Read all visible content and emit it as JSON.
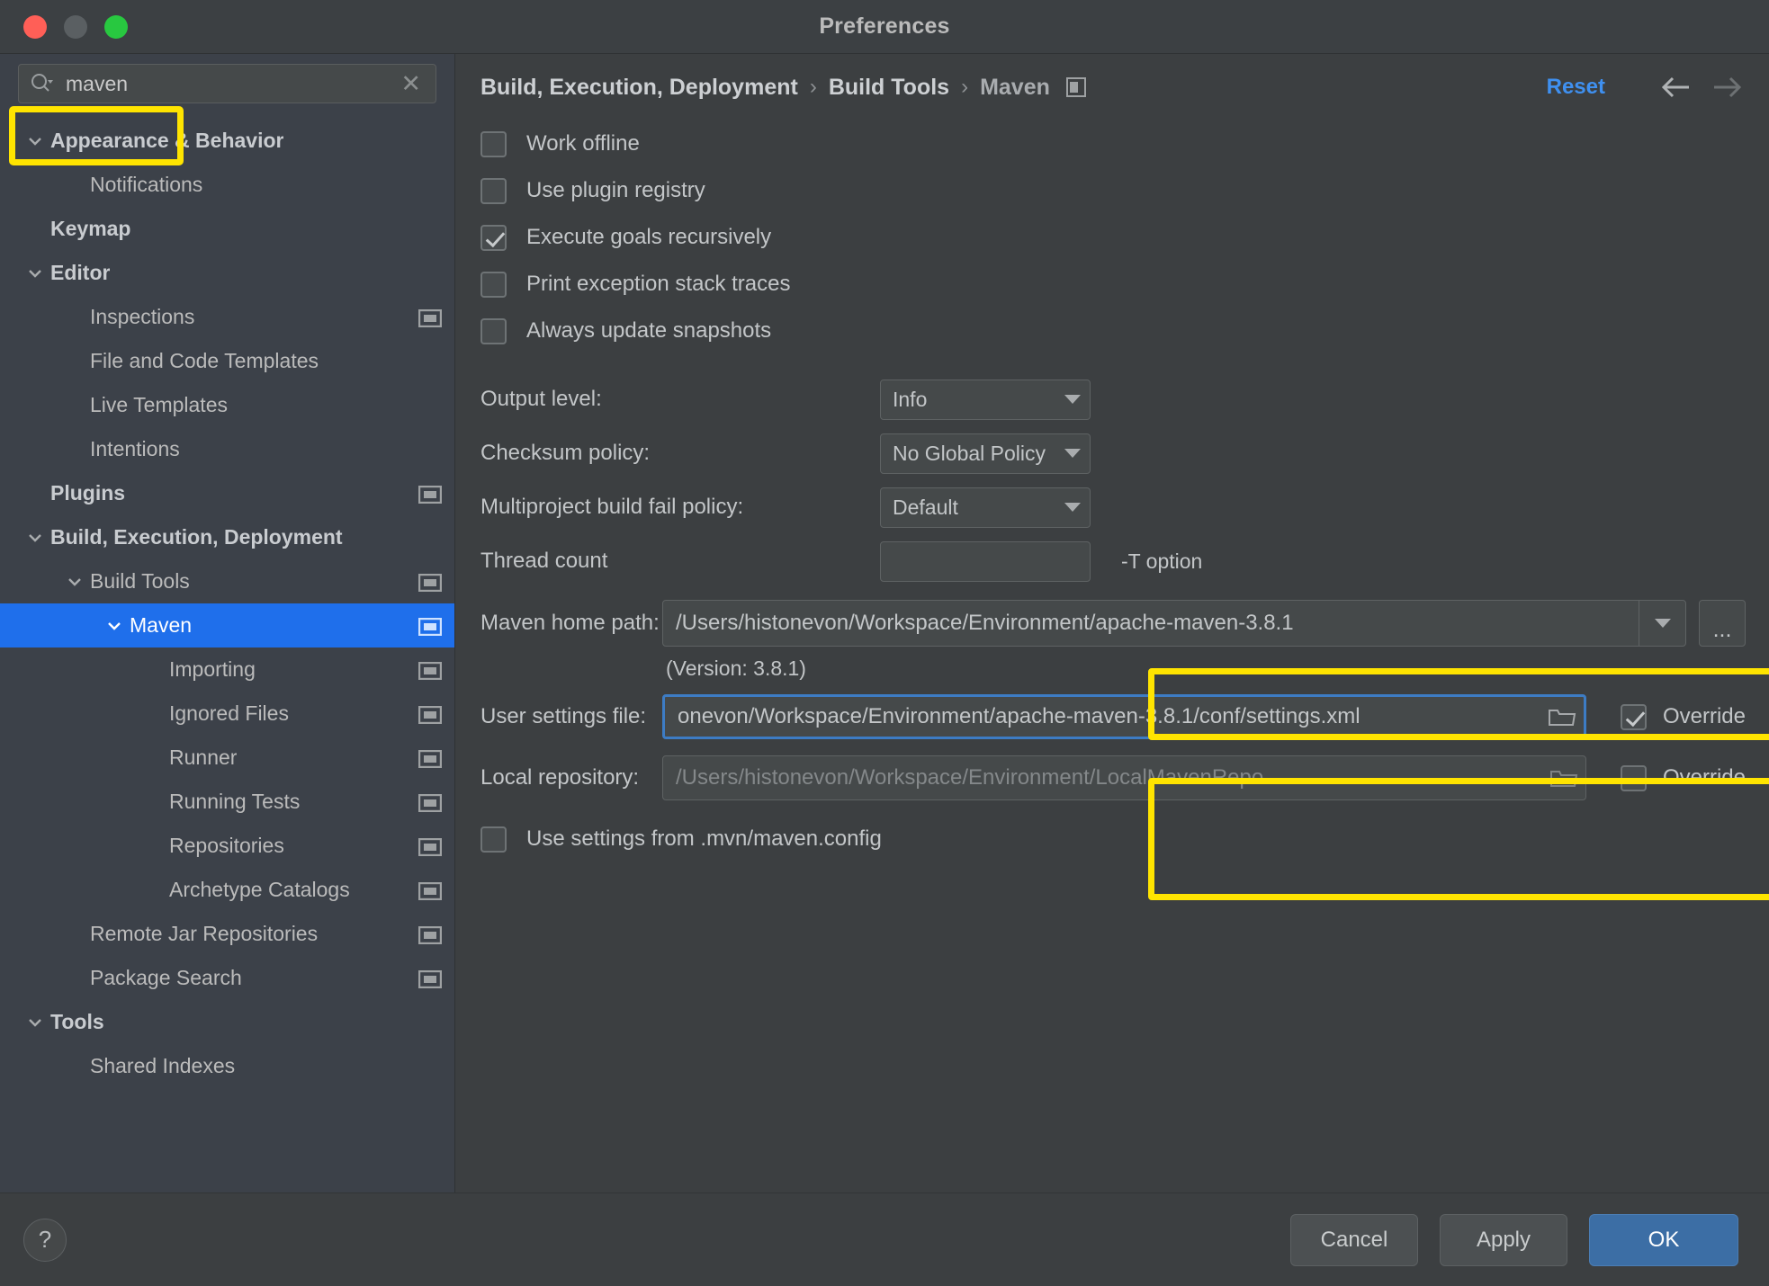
{
  "window": {
    "title": "Preferences",
    "traffic_lights": [
      "close-button",
      "minimize-button",
      "maximize-button"
    ]
  },
  "sidebar": {
    "search": {
      "icon": "search-icon",
      "value": "maven",
      "placeholder": "",
      "clear_icon": "close-icon"
    },
    "items": [
      {
        "label": "Appearance & Behavior",
        "indent": 0,
        "bold": true,
        "expandable": true,
        "expanded": true,
        "selected": false,
        "panel_icon": false
      },
      {
        "label": "Notifications",
        "indent": 1,
        "bold": false,
        "expandable": false,
        "expanded": false,
        "selected": false,
        "panel_icon": false
      },
      {
        "label": "Keymap",
        "indent": 0,
        "bold": true,
        "expandable": false,
        "expanded": false,
        "selected": false,
        "panel_icon": false
      },
      {
        "label": "Editor",
        "indent": 0,
        "bold": true,
        "expandable": true,
        "expanded": true,
        "selected": false,
        "panel_icon": false
      },
      {
        "label": "Inspections",
        "indent": 1,
        "bold": false,
        "expandable": false,
        "expanded": false,
        "selected": false,
        "panel_icon": true
      },
      {
        "label": "File and Code Templates",
        "indent": 1,
        "bold": false,
        "expandable": false,
        "expanded": false,
        "selected": false,
        "panel_icon": false
      },
      {
        "label": "Live Templates",
        "indent": 1,
        "bold": false,
        "expandable": false,
        "expanded": false,
        "selected": false,
        "panel_icon": false
      },
      {
        "label": "Intentions",
        "indent": 1,
        "bold": false,
        "expandable": false,
        "expanded": false,
        "selected": false,
        "panel_icon": false
      },
      {
        "label": "Plugins",
        "indent": 0,
        "bold": true,
        "expandable": false,
        "expanded": false,
        "selected": false,
        "panel_icon": true
      },
      {
        "label": "Build, Execution, Deployment",
        "indent": 0,
        "bold": true,
        "expandable": true,
        "expanded": true,
        "selected": false,
        "panel_icon": false
      },
      {
        "label": "Build Tools",
        "indent": 1,
        "bold": false,
        "expandable": true,
        "expanded": true,
        "selected": false,
        "panel_icon": true
      },
      {
        "label": "Maven",
        "indent": 2,
        "bold": false,
        "expandable": true,
        "expanded": true,
        "selected": true,
        "panel_icon": true
      },
      {
        "label": "Importing",
        "indent": 3,
        "bold": false,
        "expandable": false,
        "expanded": false,
        "selected": false,
        "panel_icon": true
      },
      {
        "label": "Ignored Files",
        "indent": 3,
        "bold": false,
        "expandable": false,
        "expanded": false,
        "selected": false,
        "panel_icon": true
      },
      {
        "label": "Runner",
        "indent": 3,
        "bold": false,
        "expandable": false,
        "expanded": false,
        "selected": false,
        "panel_icon": true
      },
      {
        "label": "Running Tests",
        "indent": 3,
        "bold": false,
        "expandable": false,
        "expanded": false,
        "selected": false,
        "panel_icon": true
      },
      {
        "label": "Repositories",
        "indent": 3,
        "bold": false,
        "expandable": false,
        "expanded": false,
        "selected": false,
        "panel_icon": true
      },
      {
        "label": "Archetype Catalogs",
        "indent": 3,
        "bold": false,
        "expandable": false,
        "expanded": false,
        "selected": false,
        "panel_icon": true
      },
      {
        "label": "Remote Jar Repositories",
        "indent": 1,
        "bold": false,
        "expandable": false,
        "expanded": false,
        "selected": false,
        "panel_icon": true
      },
      {
        "label": "Package Search",
        "indent": 1,
        "bold": false,
        "expandable": false,
        "expanded": false,
        "selected": false,
        "panel_icon": true
      },
      {
        "label": "Tools",
        "indent": 0,
        "bold": true,
        "expandable": true,
        "expanded": true,
        "selected": false,
        "panel_icon": false
      },
      {
        "label": "Shared Indexes",
        "indent": 1,
        "bold": false,
        "expandable": false,
        "expanded": false,
        "selected": false,
        "panel_icon": false
      }
    ]
  },
  "header": {
    "breadcrumb": [
      "Build, Execution, Deployment",
      "Build Tools",
      "Maven"
    ],
    "separator": "›",
    "panel_icon": "panel-icon",
    "reset_label": "Reset",
    "back_icon": "arrow-left-icon",
    "forward_icon": "arrow-right-icon"
  },
  "main": {
    "checkboxes": [
      {
        "label": "Work offline",
        "checked": false
      },
      {
        "label": "Use plugin registry",
        "checked": false
      },
      {
        "label": "Execute goals recursively",
        "checked": true
      },
      {
        "label": "Print exception stack traces",
        "checked": false
      },
      {
        "label": "Always update snapshots",
        "checked": false
      }
    ],
    "output_level": {
      "label": "Output level:",
      "value": "Info"
    },
    "checksum_policy": {
      "label": "Checksum policy:",
      "value": "No Global Policy"
    },
    "multiproject_policy": {
      "label": "Multiproject build fail policy:",
      "value": "Default"
    },
    "thread_count": {
      "label": "Thread count",
      "value": "",
      "note": "-T option"
    },
    "maven_home": {
      "label": "Maven home path:",
      "value": "/Users/histonevon/Workspace/Environment/apache-maven-3.8.1",
      "browse_label": "...",
      "version_note": "(Version: 3.8.1)"
    },
    "user_settings": {
      "label": "User settings file:",
      "value": "onevon/Workspace/Environment/apache-maven-3.8.1/conf/settings.xml",
      "folder_icon": "folder-icon",
      "override_label": "Override",
      "override_checked": true,
      "focused": true
    },
    "local_repository": {
      "label": "Local repository:",
      "value": "/Users/histonevon/Workspace/Environment/LocalMavenRepo",
      "folder_icon": "folder-icon",
      "override_label": "Override",
      "override_checked": false,
      "disabled": true
    },
    "mvn_config": {
      "label": "Use settings from .mvn/maven.config",
      "checked": false
    }
  },
  "footer": {
    "help_label": "?",
    "cancel_label": "Cancel",
    "apply_label": "Apply",
    "ok_label": "OK"
  },
  "annotations": {
    "highlight_color": "#ffe400",
    "boxes": [
      "search-field",
      "maven-home-path",
      "settings-and-repository"
    ]
  }
}
